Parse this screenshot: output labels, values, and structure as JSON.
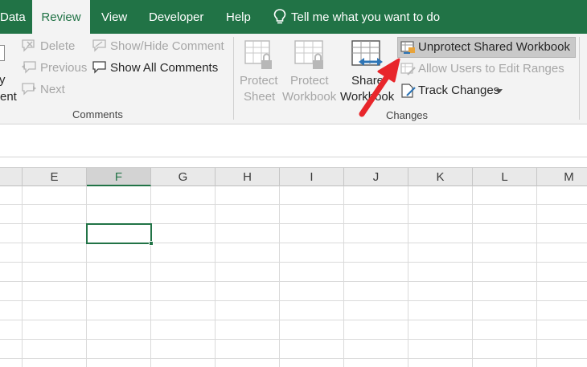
{
  "tabs": {
    "data": "Data",
    "review": "Review",
    "view": "View",
    "developer": "Developer",
    "help": "Help"
  },
  "tell_me": "Tell me what you want to do",
  "comments_group": {
    "delete": "Delete",
    "previous": "Previous",
    "next": "Next",
    "show_hide": "Show/Hide Comment",
    "show_all": "Show All Comments",
    "label": "Comments",
    "partial_left_1": "y",
    "partial_left_2": "ent"
  },
  "changes_group": {
    "protect_sheet_1": "Protect",
    "protect_sheet_2": "Sheet",
    "protect_workbook_1": "Protect",
    "protect_workbook_2": "Workbook",
    "share_workbook_1": "Share",
    "share_workbook_2": "Workbook",
    "unprotect_shared": "Unprotect Shared Workbook",
    "allow_users": "Allow Users to Edit Ranges",
    "track_changes": "Track Changes",
    "label": "Changes"
  },
  "columns": [
    "E",
    "F",
    "G",
    "H",
    "I",
    "J",
    "K",
    "L",
    "M"
  ],
  "selected_column": "F",
  "colors": {
    "excel_green": "#217346",
    "arrow_red": "#e8262b"
  }
}
